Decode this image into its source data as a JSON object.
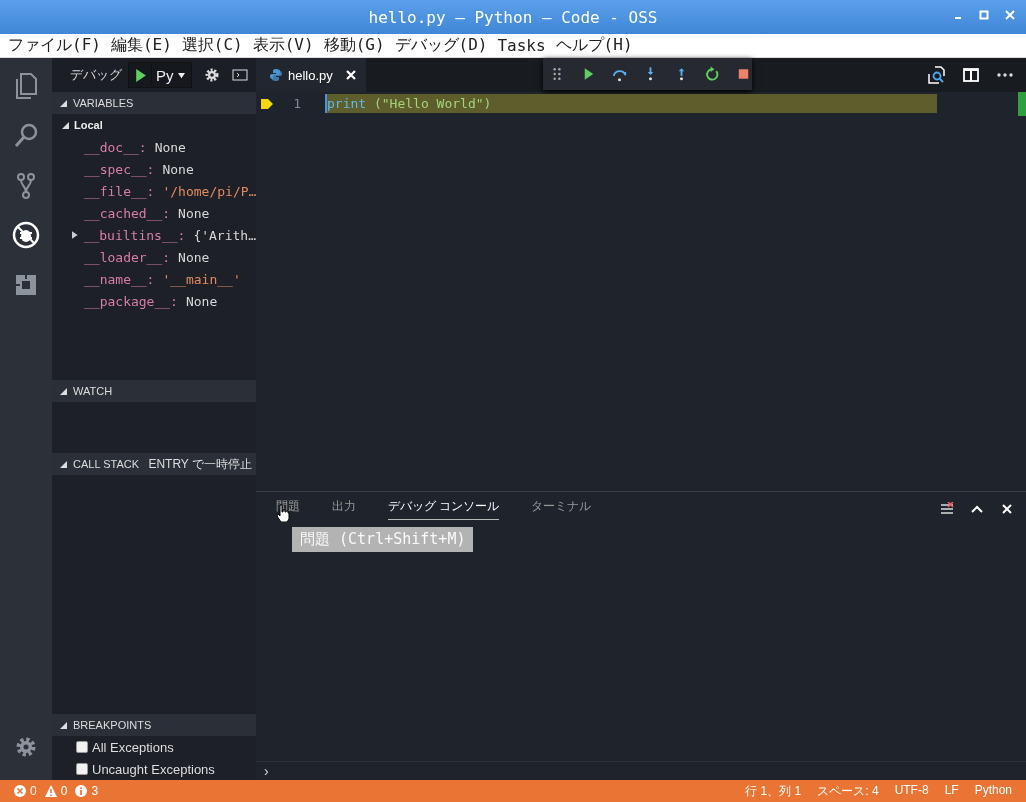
{
  "window": {
    "title": "hello.py — Python — Code - OSS"
  },
  "menu": [
    "ファイル(F)",
    "編集(E)",
    "選択(C)",
    "表示(V)",
    "移動(G)",
    "デバッグ(D)",
    "Tasks",
    "ヘルプ(H)"
  ],
  "activity_bar": [
    {
      "kind": "files",
      "selected": false
    },
    {
      "kind": "search",
      "selected": false
    },
    {
      "kind": "scm",
      "selected": false
    },
    {
      "kind": "debug",
      "selected": true
    },
    {
      "kind": "extensions",
      "selected": false
    }
  ],
  "debug_toolbar": {
    "label": "デバッグ",
    "configuration": "Py"
  },
  "variables": {
    "title": "VARIABLES",
    "scopes": [
      {
        "label": "Local",
        "expanded": true,
        "children": [
          {
            "name": "__doc__:",
            "value": "None",
            "kind": "plain",
            "expandable": false
          },
          {
            "name": "__spec__:",
            "value": "None",
            "kind": "plain",
            "expandable": false
          },
          {
            "name": "__file__:",
            "value": "'/home/pi/P…",
            "kind": "string",
            "expandable": false
          },
          {
            "name": "__cached__:",
            "value": "None",
            "kind": "plain",
            "expandable": false
          },
          {
            "name": "__builtins__:",
            "value": "{'Arith…",
            "kind": "plain",
            "expandable": true
          },
          {
            "name": "__loader__:",
            "value": "None",
            "kind": "plain",
            "expandable": false
          },
          {
            "name": "__name__:",
            "value": "'__main__'",
            "kind": "string",
            "expandable": false
          },
          {
            "name": "__package__:",
            "value": "None",
            "kind": "plain",
            "expandable": false
          }
        ]
      }
    ]
  },
  "watch": {
    "title": "WATCH"
  },
  "call_stack": {
    "title": "CALL STACK",
    "status": "ENTRY で一時停止"
  },
  "breakpoints": {
    "title": "BREAKPOINTS",
    "items": [
      {
        "label": "All Exceptions",
        "checked": false
      },
      {
        "label": "Uncaught Exceptions",
        "checked": false
      }
    ]
  },
  "editor_tabs": [
    {
      "label": "hello.py",
      "selected": true
    }
  ],
  "code": [
    {
      "number": "1",
      "current": true,
      "tokens": [
        {
          "text": "print",
          "kind": "function"
        },
        {
          "text": " (\"Hello World\")",
          "kind": "string"
        }
      ]
    }
  ],
  "panel": {
    "tabs": [
      {
        "label": "問題",
        "selected": false
      },
      {
        "label": "出力",
        "selected": false
      },
      {
        "label": "デバッグ コンソール",
        "selected": true
      },
      {
        "label": "ターミナル",
        "selected": false
      }
    ],
    "tooltip": "問題 (Ctrl+Shift+M)",
    "prompt": "›"
  },
  "status_bar": {
    "errors": "0",
    "warnings": "0",
    "infos": "3",
    "items": [
      "行 1、列 1",
      "スペース: 4",
      "UTF-8",
      "LF",
      "Python"
    ]
  }
}
